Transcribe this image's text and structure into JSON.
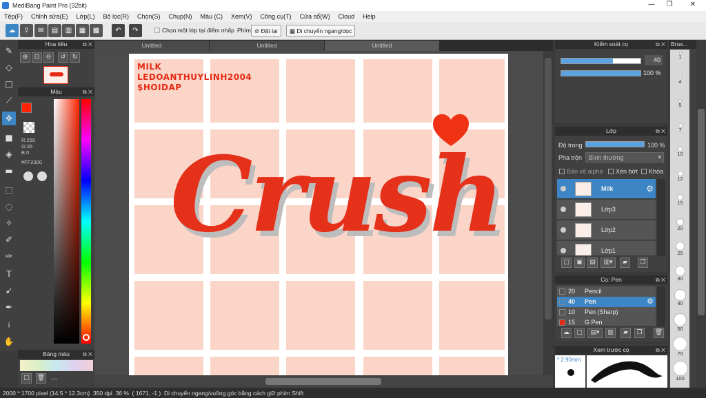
{
  "window": {
    "title": "MediBang Paint Pro (32bit)"
  },
  "menu": [
    "Tệp(F)",
    "Chỉnh sửa(E)",
    "Lớp(L)",
    "Bộ lọc(R)",
    "Chọn(S)",
    "Chụp(N)",
    "Màu (C)",
    "Xem(V)",
    "Công cụ(T)",
    "Cửa sổ(W)",
    "Cloud",
    "Help"
  ],
  "toolbar": {
    "select_layer_label": "Chọn một lớp tại điểm nhấp",
    "key_label": "Phím",
    "reset_label": "Đặt lại",
    "move_label": "Di chuyển ngang/dọc"
  },
  "navigator": {
    "title": "Hoa tiêu"
  },
  "color_panel": {
    "title": "Màu",
    "r": "R:255",
    "g": "G:35",
    "b": "B:0",
    "hex": "#FF2300",
    "current_color": "#ff2300"
  },
  "palette": {
    "title": "Bảng màu",
    "extra": "---"
  },
  "tabs": [
    "Untitled",
    "Untitled",
    "Untitled"
  ],
  "canvas": {
    "watermark": [
      "MILK",
      "LEDOANTHUYLINH2004",
      "$HOIDAP"
    ],
    "artwork_text": "Crush"
  },
  "brush_control": {
    "title": "Kiểm soát cọ",
    "size": "40",
    "opacity": "100 %",
    "size_fraction": 0.65,
    "opacity_fraction": 1.0
  },
  "layers": {
    "title": "Lớp",
    "opacity_label": "Độ trong",
    "opacity_value": "100 %",
    "blend_label": "Pha trộn",
    "blend_value": "Bình thường",
    "protect_alpha": "Bảo vệ alpha",
    "clip": "Xén bớt",
    "lock": "Khóa",
    "items": [
      {
        "name": "Milk",
        "selected": true
      },
      {
        "name": "Lớp3",
        "selected": false
      },
      {
        "name": "Lớp2",
        "selected": false
      },
      {
        "name": "Lớp1",
        "selected": false
      }
    ]
  },
  "brushes": {
    "title": "Cọ: Pen",
    "items": [
      {
        "size": "20",
        "name": "Pencil",
        "color": "#222222",
        "selected": false
      },
      {
        "size": "40",
        "name": "Pen",
        "color": "#222222",
        "selected": true
      },
      {
        "size": "10",
        "name": "Pen (Sharp)",
        "color": "#222222",
        "selected": false
      },
      {
        "size": "15",
        "name": "G Pen",
        "color": "#e52a14",
        "selected": false
      }
    ]
  },
  "preview": {
    "title": "Xem trước cọ",
    "size": "* 2.90mm"
  },
  "brush_sizes": {
    "title": "Brus...",
    "values": [
      "1",
      "4",
      "5",
      "7",
      "10",
      "12",
      "15",
      "20",
      "25",
      "30",
      "40",
      "50",
      "70",
      "100"
    ]
  },
  "status": {
    "dimensions": "2000 * 1700 pixel",
    "physical": "(14.5 * 12.3cm)",
    "dpi": "350 dpi",
    "zoom": "36 %",
    "coords": "( 1671, -1 )",
    "hint": "Di chuyển ngang/vuông góc bằng cách giữ phím Shift"
  }
}
